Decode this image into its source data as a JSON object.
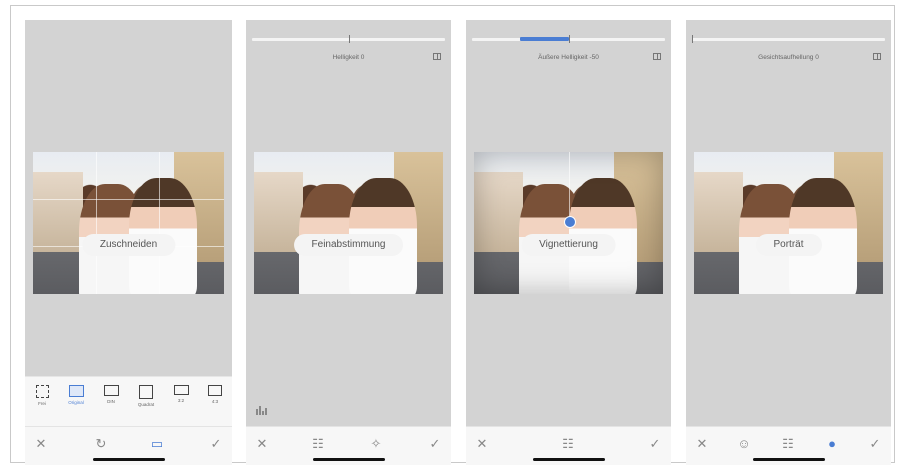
{
  "panels": [
    {
      "id": "crop",
      "photo_label": "Zuschneiden",
      "crop_options": [
        {
          "label": "Frei",
          "icon": "free-crop-icon",
          "active": false
        },
        {
          "label": "Original",
          "icon": "original-ratio-icon",
          "active": true
        },
        {
          "label": "DIN",
          "icon": "din-ratio-icon",
          "active": false
        },
        {
          "label": "Quadrat",
          "icon": "square-ratio-icon",
          "active": false
        },
        {
          "label": "3:2",
          "icon": "ratio-3-2-icon",
          "active": false
        },
        {
          "label": "4:3",
          "icon": "ratio-4-3-icon",
          "active": false
        }
      ],
      "bottom_icons": [
        "close-icon",
        "rotate-icon",
        "aspect-ratio-icon",
        "check-icon"
      ]
    },
    {
      "id": "tune",
      "adjust_label": "Helligkeit 0",
      "photo_label": "Feinabstimmung",
      "bottom_icons": [
        "close-icon",
        "sliders-icon",
        "auto-adjust-icon",
        "check-icon"
      ]
    },
    {
      "id": "vignette",
      "adjust_label": "Äußere Helligkeit -50",
      "adjust_fraction": -0.5,
      "photo_label": "Vignettierung",
      "bottom_icons": [
        "close-icon",
        "sliders-icon",
        "check-icon"
      ]
    },
    {
      "id": "portrait",
      "adjust_label": "Gesichtsaufhellung 0",
      "photo_label": "Porträt",
      "bottom_icons": [
        "close-icon",
        "face-icon",
        "sliders-icon",
        "skin-tone-icon",
        "check-icon"
      ]
    }
  ],
  "colors": {
    "accent": "#4a7dd3",
    "panel_bg": "#d3d3d3",
    "toolbar_bg": "#f7f7f7"
  }
}
